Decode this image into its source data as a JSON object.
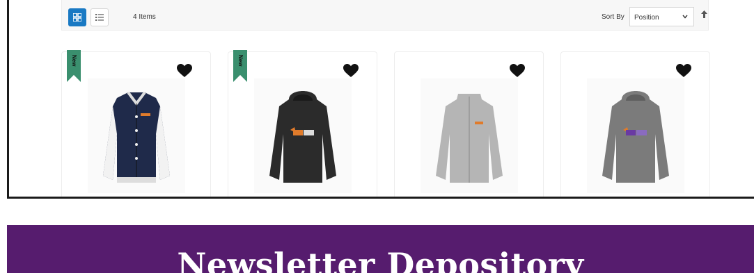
{
  "toolbar": {
    "item_count": "4 Items",
    "sort_label": "Sort By",
    "sort_value": "Position"
  },
  "products": [
    {
      "badge": "New",
      "style": "varsity-jacket",
      "hood_color": "#1f2a4a"
    },
    {
      "badge": "New",
      "style": "hoodie",
      "hood_color": "#2b2b2b"
    },
    {
      "badge": "",
      "style": "zip-jacket",
      "hood_color": "#b5b5b5"
    },
    {
      "badge": "",
      "style": "hoodie",
      "hood_color": "#7b7b7b"
    }
  ],
  "banner": {
    "title": "Newsletter Depository",
    "color": "#561c6e"
  }
}
